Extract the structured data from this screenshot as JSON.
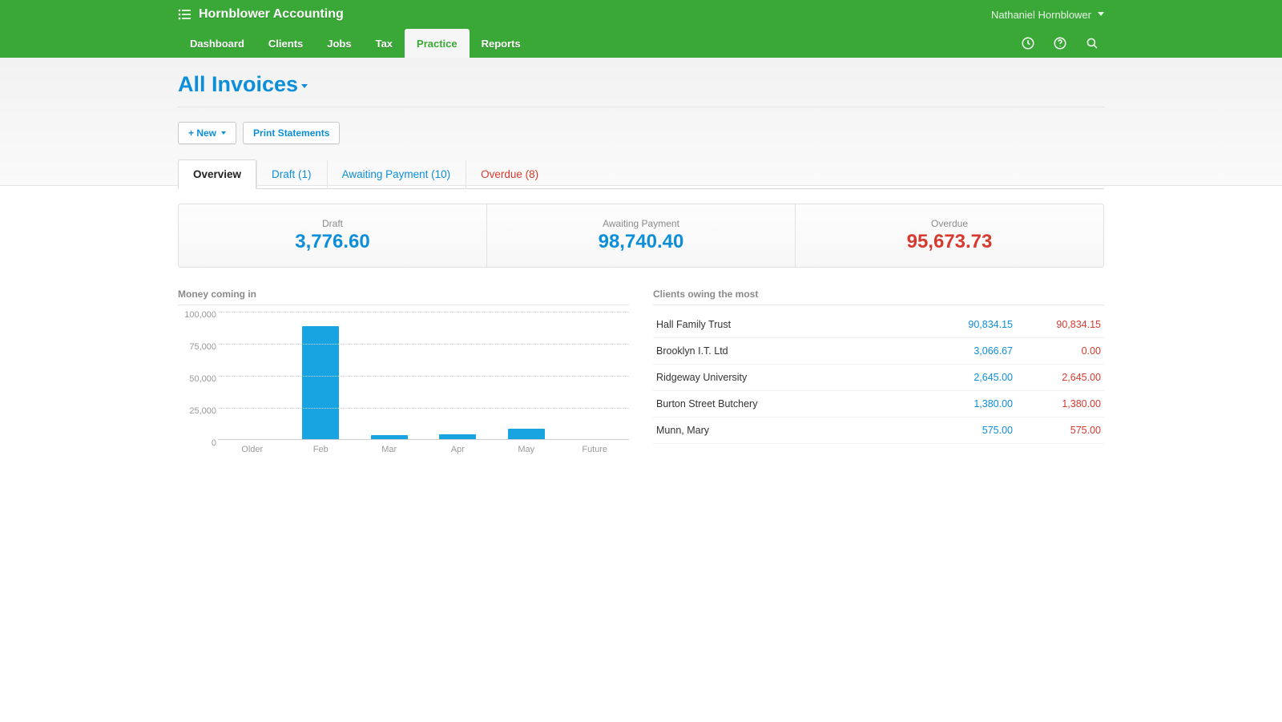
{
  "header": {
    "org_name": "Hornblower Accounting",
    "user_name": "Nathaniel Hornblower"
  },
  "nav": {
    "items": [
      "Dashboard",
      "Clients",
      "Jobs",
      "Tax",
      "Practice",
      "Reports"
    ],
    "active_index": 4
  },
  "page": {
    "title": "All Invoices",
    "actions": {
      "new_label": "+ New",
      "print_statements_label": "Print Statements"
    }
  },
  "tabs": {
    "items": [
      {
        "label": "Overview",
        "kind": "normal",
        "active": true
      },
      {
        "label": "Draft (1)",
        "kind": "normal",
        "active": false
      },
      {
        "label": "Awaiting Payment (10)",
        "kind": "normal",
        "active": false
      },
      {
        "label": "Overdue (8)",
        "kind": "overdue",
        "active": false
      }
    ]
  },
  "summary": {
    "draft": {
      "label": "Draft",
      "value": "3,776.60"
    },
    "awaiting": {
      "label": "Awaiting Payment",
      "value": "98,740.40"
    },
    "overdue": {
      "label": "Overdue",
      "value": "95,673.73"
    }
  },
  "chart_panel": {
    "title": "Money coming in"
  },
  "chart_data": {
    "type": "bar",
    "categories": [
      "Older",
      "Feb",
      "Mar",
      "Apr",
      "May",
      "Future"
    ],
    "values": [
      0,
      88000,
      3000,
      4000,
      8000,
      0
    ],
    "title": "Money coming in",
    "xlabel": "",
    "ylabel": "",
    "ylim": [
      0,
      100000
    ],
    "y_ticks": [
      "0",
      "25,000",
      "50,000",
      "75,000",
      "100,000"
    ]
  },
  "clients_panel": {
    "title": "Clients owing the most",
    "rows": [
      {
        "name": "Hall Family Trust",
        "due": "90,834.15",
        "overdue": "90,834.15"
      },
      {
        "name": "Brooklyn I.T. Ltd",
        "due": "3,066.67",
        "overdue": "0.00"
      },
      {
        "name": "Ridgeway University",
        "due": "2,645.00",
        "overdue": "2,645.00"
      },
      {
        "name": "Burton Street Butchery",
        "due": "1,380.00",
        "overdue": "1,380.00"
      },
      {
        "name": "Munn, Mary",
        "due": "575.00",
        "overdue": "575.00"
      }
    ]
  }
}
